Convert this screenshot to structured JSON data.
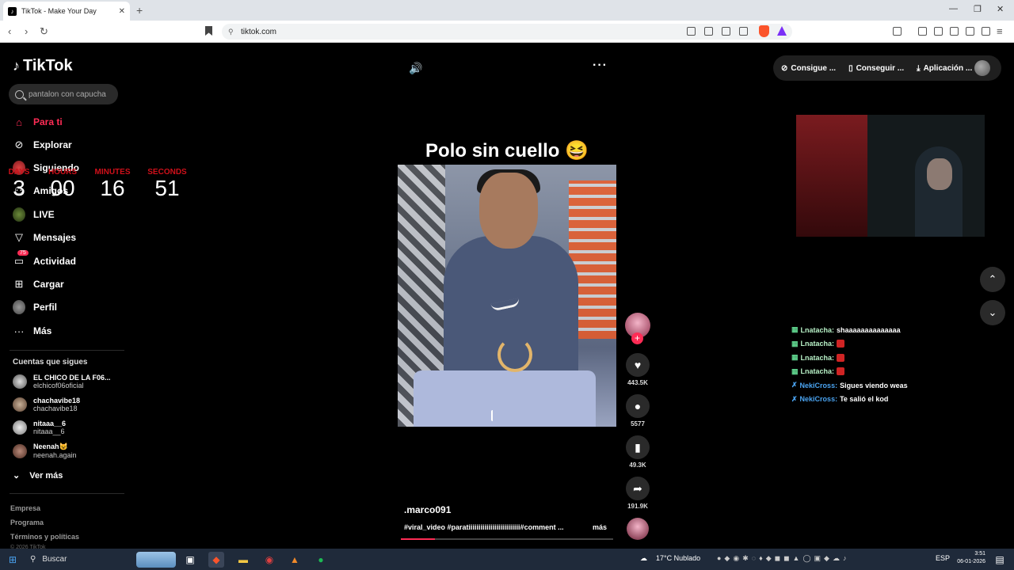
{
  "browser": {
    "tab_title": "TikTok - Make Your Day",
    "new_tab": "+",
    "url": "tiktok.com"
  },
  "tiktok": {
    "logo": "TikTok",
    "search_placeholder": "pantalon con capucha",
    "menu": [
      {
        "label": "Para ti",
        "icon": "home-icon"
      },
      {
        "label": "Explorar",
        "icon": "compass-icon"
      },
      {
        "label": "Siguiendo",
        "icon": "avatar"
      },
      {
        "label": "Amigos",
        "icon": "friends-icon"
      },
      {
        "label": "LIVE",
        "icon": "live-icon"
      },
      {
        "label": "Mensajes",
        "icon": "send-icon"
      },
      {
        "label": "Actividad",
        "icon": "inbox-icon",
        "badge": "75"
      },
      {
        "label": "Cargar",
        "icon": "plus-square-icon"
      },
      {
        "label": "Perfil",
        "icon": "avatar"
      },
      {
        "label": "Más",
        "icon": "more-icon"
      }
    ],
    "timer": {
      "labels": [
        "DAYS",
        "HOURS",
        "MINUTES",
        "SECONDS"
      ],
      "values": [
        "3",
        "00",
        "16",
        "51"
      ]
    },
    "following_title": "Cuentas que sigues",
    "accounts": [
      {
        "name": "EL CHICO DE LA F06...",
        "handle": "elchicof06oficial"
      },
      {
        "name": "chachavibe18",
        "handle": "chachavibe18"
      },
      {
        "name": "nitaaa__6",
        "handle": "nitaaa__6"
      },
      {
        "name": "Neenah😺",
        "handle": "neenah.again"
      }
    ],
    "see_more": "Ver más",
    "footer": [
      "Empresa",
      "Programa",
      "Términos y políticas",
      "© 2026 TikTok"
    ],
    "top_actions": [
      "Consigue ...",
      "Conseguir ...",
      "Aplicación ..."
    ],
    "video": {
      "title": "Polo sin cuello 😆",
      "author": ".marco091",
      "description": "#viral_video #paratiiiiiiiiiiiiiiiiiiiiiiiiii#comment ...",
      "more": "más",
      "progress": 0.16
    },
    "actions": {
      "likes": "443.5K",
      "comments": "5577",
      "saves": "49.3K",
      "shares": "191.9K"
    },
    "chat": [
      {
        "user": "Lnatacha:",
        "msg": "shaaaaaaaaaaaaaa",
        "type": "u1"
      },
      {
        "user": "Lnatacha:",
        "msg": "",
        "type": "u1"
      },
      {
        "user": "Lnatacha:",
        "msg": "",
        "type": "u1"
      },
      {
        "user": "Lnatacha:",
        "msg": "",
        "type": "u1"
      },
      {
        "user": "NekiCross:",
        "msg": "Sigues viendo weas",
        "type": "u2"
      },
      {
        "user": "NekiCross:",
        "msg": "Te salió el kod",
        "type": "u2"
      }
    ]
  },
  "taskbar": {
    "search": "Buscar",
    "weather": "17°C  Nublado",
    "lang": "ESP",
    "time": "3:51",
    "date": "06-01-2026"
  },
  "colors": {
    "accent": "#fe2c55",
    "timer_head": "#d0101a"
  }
}
